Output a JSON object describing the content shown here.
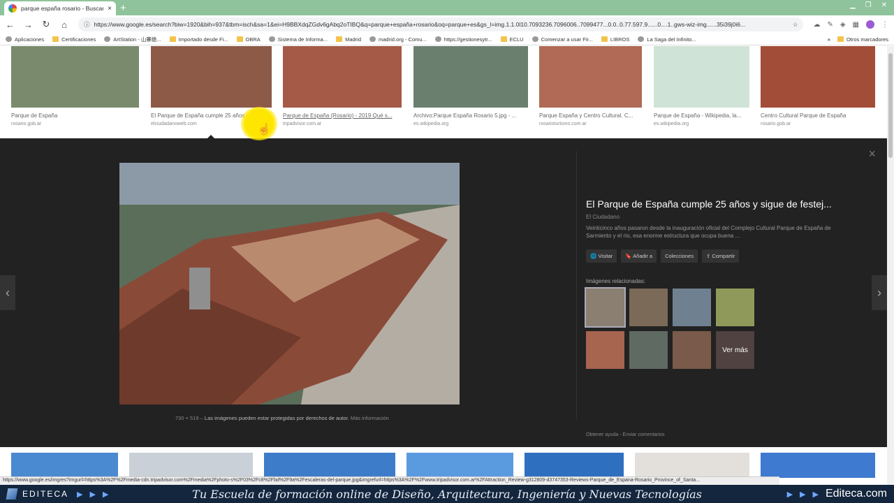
{
  "browser": {
    "tab_title": "parque españa rosario - Buscar c",
    "tab_close": "×",
    "new_tab": "+",
    "url": "https://www.google.es/search?biw=1920&bih=937&tbm=isch&sa=1&ei=H9BBXdqZGdv6gAbq2oTIBQ&q=parque+españa+rosario&oq=parque+es&gs_l=img.1.1.0l10.7093236.7096006..7099477...0.0..0.77.597.9......0....1..gws-wiz-img......35i39j0i6..."
  },
  "bookmarks": [
    {
      "label": "Aplicaciones"
    },
    {
      "label": "Certificaciones"
    },
    {
      "label": "ArtStation - 山寨绝..."
    },
    {
      "label": "Importado desde Fi..."
    },
    {
      "label": "OBRA"
    },
    {
      "label": "Sistema de Informa..."
    },
    {
      "label": "Madrid"
    },
    {
      "label": "madrid.org - Comu..."
    },
    {
      "label": "https://gestionesytr..."
    },
    {
      "label": "ECLU"
    },
    {
      "label": "Comenzar a usar Fir..."
    },
    {
      "label": "LIBROS"
    },
    {
      "label": "La Saga del Infinito..."
    }
  ],
  "bookmarks_more": "»",
  "bookmarks_other": "Otros marcadores",
  "results_top": [
    {
      "caption": "Parque de España",
      "source": "rosario.gob.ar",
      "color": "#7a8a6d"
    },
    {
      "caption": "El Parque de España cumple 25 años y sig...",
      "source": "elciudadanoweb.com",
      "color": "#8d5a48"
    },
    {
      "caption": "Parque de España (Rosario) - 2019 Qué s...",
      "source": "tripadvisor.com.ar",
      "color": "#a45a47"
    },
    {
      "caption": "Archivo:Parque España Rosario 5.jpg - ...",
      "source": "es.wikipedia.org",
      "color": "#6b7f6e"
    },
    {
      "caption": "Parque España y Centro Cultural. C...",
      "source": "rosarioturismo.com.ar",
      "color": "#b06a55"
    },
    {
      "caption": "Parque de España - Wikipedia, la...",
      "source": "es.wikipedia.org",
      "color": "#cfe3d6"
    },
    {
      "caption": "Centro Cultural Parque de España",
      "source": "rosario.gob.ar",
      "color": "#a24d38"
    }
  ],
  "viewer": {
    "title": "El Parque de España cumple 25 años y sigue de festej...",
    "site": "El Ciudadano",
    "description": "Veinticinco años pasaron desde la inauguración oficial del Complejo Cultural Parque de España de Sarmiento y el río, esa enorme estructura que ocupa buena ...",
    "actions": {
      "visit": "Visitar",
      "add": "Añadir a",
      "collections": "Colecciones",
      "share": "Compartir"
    },
    "related_label": "Imágenes relacionadas:",
    "see_more": "Ver más",
    "dimensions": "730 × 519",
    "copyright": "Las imágenes pueden estar protegidas por derechos de autor.",
    "more_info": "Más información",
    "help": "Obtener ayuda",
    "feedback": "Enviar comentarios",
    "close": "×",
    "prev": "‹",
    "next": "›"
  },
  "related": [
    {
      "color": "#8a7f70"
    },
    {
      "color": "#7b6a58"
    },
    {
      "color": "#6f8090"
    },
    {
      "color": "#8f9a5a"
    },
    {
      "color": "#a7644f"
    },
    {
      "color": "#5f6a62"
    },
    {
      "color": "#7a5a4a"
    },
    {
      "color": "#6a5450"
    }
  ],
  "results_bottom": [
    {
      "color": "#4a8ad0"
    },
    {
      "color": "#c9d0d8"
    },
    {
      "color": "#3d7cc9"
    },
    {
      "color": "#5a9be0"
    },
    {
      "color": "#2f6fc0"
    },
    {
      "color": "#e3e0dc"
    },
    {
      "color": "#3d7ad0"
    }
  ],
  "status_url": "https://www.google.es/imgres?imgurl=https%3A%2F%2Fmedia-cdn.tripadvisor.com%2Fmedia%2Fphoto-s%2F03%2Fc8%2Fbd%2F9a%2Fescaleras-del-parque.jpg&imgrefurl=https%3A%2F%2Fwww.tripadvisor.com.ar%2FAttraction_Review-g312809-d3747353-Reviews-Parque_de_Espana-Rosario_Province_of_Santa...",
  "banner": {
    "brand": "EDITECA",
    "slogan": "Tu Escuela de formación online de Diseño, Arquitectura, Ingeniería y Nuevas Tecnologías",
    "url": "Editeca.com"
  }
}
